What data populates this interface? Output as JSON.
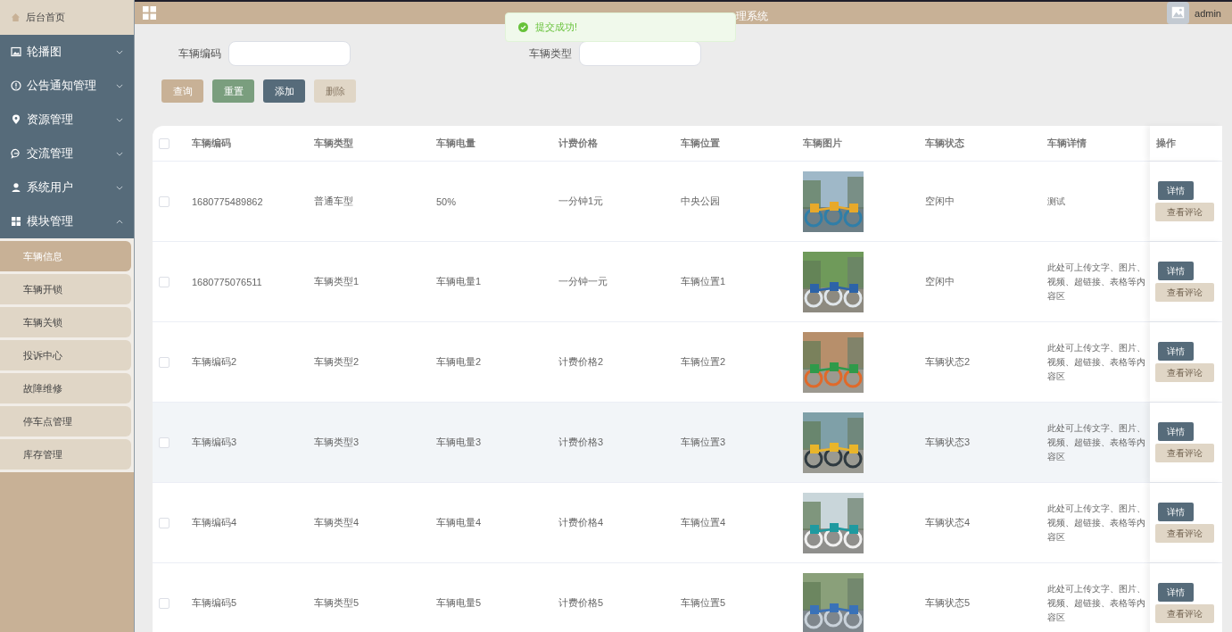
{
  "sidebar": {
    "home": "后台首页",
    "menus": [
      {
        "label": "轮播图",
        "expanded": false
      },
      {
        "label": "公告通知管理",
        "expanded": false
      },
      {
        "label": "资源管理",
        "expanded": false
      },
      {
        "label": "交流管理",
        "expanded": false
      },
      {
        "label": "系统用户",
        "expanded": false
      },
      {
        "label": "模块管理",
        "expanded": true,
        "children": [
          {
            "label": "车辆信息",
            "selected": true
          },
          {
            "label": "车辆开锁",
            "selected": false
          },
          {
            "label": "车辆关锁",
            "selected": false
          },
          {
            "label": "投诉中心",
            "selected": false
          },
          {
            "label": "故障维修",
            "selected": false
          },
          {
            "label": "停车点管理",
            "selected": false
          },
          {
            "label": "库存管理",
            "selected": false
          }
        ]
      }
    ]
  },
  "header": {
    "title": "理系统",
    "user": "admin"
  },
  "toast": {
    "message": "提交成功!"
  },
  "search": {
    "fields": [
      {
        "label": "车辆编码"
      },
      {
        "label": "车辆类型"
      }
    ],
    "buttons": [
      {
        "label": "查询",
        "kind": "query",
        "disabled": false
      },
      {
        "label": "重置",
        "kind": "reset",
        "disabled": false
      },
      {
        "label": "添加",
        "kind": "add",
        "disabled": false
      },
      {
        "label": "删除",
        "kind": "delete",
        "disabled": true
      }
    ]
  },
  "table": {
    "columns": [
      "车辆编码",
      "车辆类型",
      "车辆电量",
      "计费价格",
      "车辆位置",
      "车辆图片",
      "车辆状态",
      "车辆详情",
      "操作"
    ],
    "select_all_checked": false,
    "rows": [
      {
        "checked": false,
        "hovered": false,
        "cells": [
          "1680775489862",
          "普通车型",
          "50%",
          "一分钟1元",
          "中央公园"
        ],
        "status": "空闲中",
        "detail": "测试",
        "actions": [
          "详情",
          "查看评论"
        ]
      },
      {
        "checked": false,
        "hovered": false,
        "cells": [
          "1680775076511",
          "车辆类型1",
          "车辆电量1",
          "一分钟一元",
          "车辆位置1"
        ],
        "status": "空闲中",
        "detail": "此处可上传文字、图片、视频、超链接、表格等内容区",
        "actions": [
          "详情",
          "查看评论"
        ]
      },
      {
        "checked": false,
        "hovered": false,
        "cells": [
          "车辆编码2",
          "车辆类型2",
          "车辆电量2",
          "计费价格2",
          "车辆位置2"
        ],
        "status": "车辆状态2",
        "detail": "此处可上传文字、图片、视频、超链接、表格等内容区",
        "actions": [
          "详情",
          "查看评论"
        ]
      },
      {
        "checked": false,
        "hovered": true,
        "cells": [
          "车辆编码3",
          "车辆类型3",
          "车辆电量3",
          "计费价格3",
          "车辆位置3"
        ],
        "status": "车辆状态3",
        "detail": "此处可上传文字、图片、视频、超链接、表格等内容区",
        "actions": [
          "详情",
          "查看评论"
        ]
      },
      {
        "checked": false,
        "hovered": false,
        "cells": [
          "车辆编码4",
          "车辆类型4",
          "车辆电量4",
          "计费价格4",
          "车辆位置4"
        ],
        "status": "车辆状态4",
        "detail": "此处可上传文字、图片、视频、超链接、表格等内容区",
        "actions": [
          "详情",
          "查看评论"
        ]
      },
      {
        "checked": false,
        "hovered": false,
        "cells": [
          "车辆编码5",
          "车辆类型5",
          "车辆电量5",
          "计费价格5",
          "车辆位置5"
        ],
        "status": "车辆状态5",
        "detail": "此处可上传文字、图片、视频、超链接、表格等内容区",
        "actions": [
          "详情",
          "查看评论"
        ]
      }
    ]
  }
}
